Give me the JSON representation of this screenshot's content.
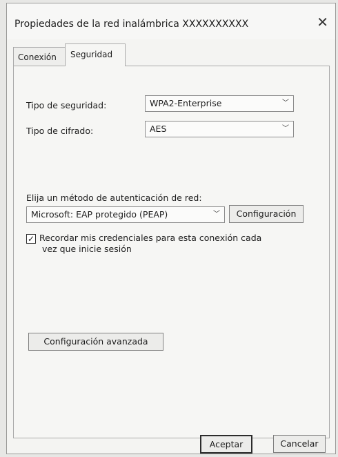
{
  "window": {
    "title": "Propiedades de la red inalámbrica XXXXXXXXXX"
  },
  "tabs": [
    {
      "label": "Conexión"
    },
    {
      "label": "Seguridad"
    }
  ],
  "security": {
    "type_label": "Tipo de seguridad:",
    "type_value": "WPA2-Enterprise",
    "encryption_label": "Tipo de cifrado:",
    "encryption_value": "AES"
  },
  "auth": {
    "label": "Elija un método de autenticación de red:",
    "method_value": "Microsoft: EAP protegido (PEAP)",
    "config_button": "Configuración",
    "remember_checked": true,
    "remember_line1": "Recordar mis credenciales para esta conexión cada",
    "remember_line2": "vez que inicie sesión"
  },
  "advanced_button": "Configuración avanzada",
  "footer": {
    "ok": "Aceptar",
    "cancel": "Cancelar"
  },
  "icons": {
    "close": "close-icon",
    "chevron": "chevron-down-icon",
    "check": "checkmark-icon"
  }
}
